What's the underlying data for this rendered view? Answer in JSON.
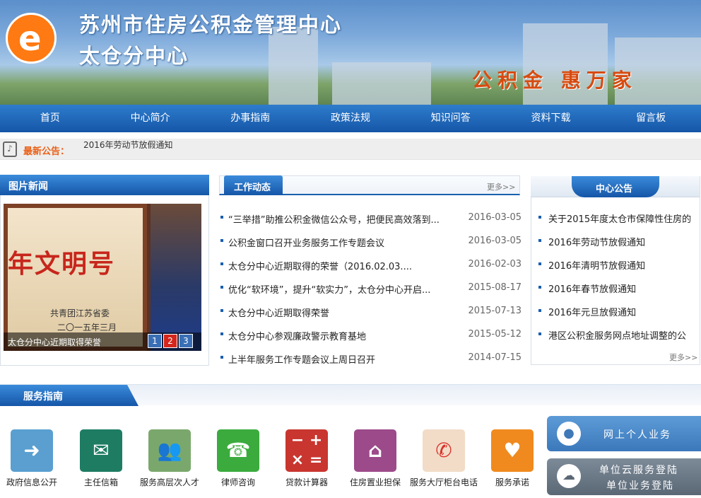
{
  "header": {
    "logo_letter": "e",
    "title": "苏州市住房公积金管理中心",
    "subtitle": "太仓分中心",
    "slogan": "公积金 惠万家"
  },
  "nav": [
    "首页",
    "中心简介",
    "办事指南",
    "政策法规",
    "知识问答",
    "资料下载",
    "留言板"
  ],
  "notice": {
    "label": "最新公告：",
    "text": "2016年劳动节放假通知"
  },
  "photo_news": {
    "title": "图片新闻",
    "plaque_text": "年文明号",
    "plaque_line1": "共青团江苏省委",
    "plaque_line2": "二〇一五年三月",
    "caption": "太仓分中心近期取得荣誉",
    "pages": [
      "1",
      "2",
      "3"
    ]
  },
  "work_news": {
    "tab": "工作动态",
    "more": "更多>>",
    "items": [
      {
        "title": "“三举措”助推公积金微信公众号，把便民高效落到...",
        "date": "2016-03-05"
      },
      {
        "title": "公积金窗口召开业务服务工作专题会议",
        "date": "2016-03-05"
      },
      {
        "title": "太仓分中心近期取得的荣誉（2016.02.03....",
        "date": "2016-02-03"
      },
      {
        "title": "优化“软环境”，提升“软实力”，太仓分中心开启...",
        "date": "2015-08-17"
      },
      {
        "title": "太仓分中心近期取得荣誉",
        "date": "2015-07-13"
      },
      {
        "title": "太仓分中心参观廉政警示教育基地",
        "date": "2015-05-12"
      },
      {
        "title": "上半年服务工作专题会议上周日召开",
        "date": "2014-07-15"
      }
    ]
  },
  "announcements": {
    "title": "中心公告",
    "more": "更多>>",
    "items": [
      "关于2015年度太仓市保障性住房的",
      "2016年劳动节放假通知",
      "2016年清明节放假通知",
      "2016年春节放假通知",
      "2016年元旦放假通知",
      "港区公积金服务网点地址调整的公"
    ]
  },
  "services": {
    "title": "服务指南",
    "items": [
      {
        "label": "政府信息公开",
        "icon": "arrow-right-icon",
        "color": "#5a9fd0"
      },
      {
        "label": "主任信箱",
        "icon": "envelope-icon",
        "color": "#1e7c63"
      },
      {
        "label": "服务高层次人才",
        "icon": "people-icon",
        "color": "#7aa86c"
      },
      {
        "label": "律师咨询",
        "icon": "phone-icon",
        "color": "#3bab3e"
      },
      {
        "label": "贷款计算器",
        "icon": "calculator-icon",
        "color": "#c8362f"
      },
      {
        "label": "住房置业担保",
        "icon": "house-icon",
        "color": "#9c4a8a"
      },
      {
        "label": "服务大厅柜台电话",
        "icon": "handset-icon",
        "color": "#f2dcc8"
      },
      {
        "label": "服务承诺",
        "icon": "heart-icon",
        "color": "#f08a1e"
      }
    ]
  },
  "side_buttons": {
    "personal": "网上个人业务",
    "unit_line1": "单位云服务登陆",
    "unit_line2": "单位业务登陆"
  }
}
